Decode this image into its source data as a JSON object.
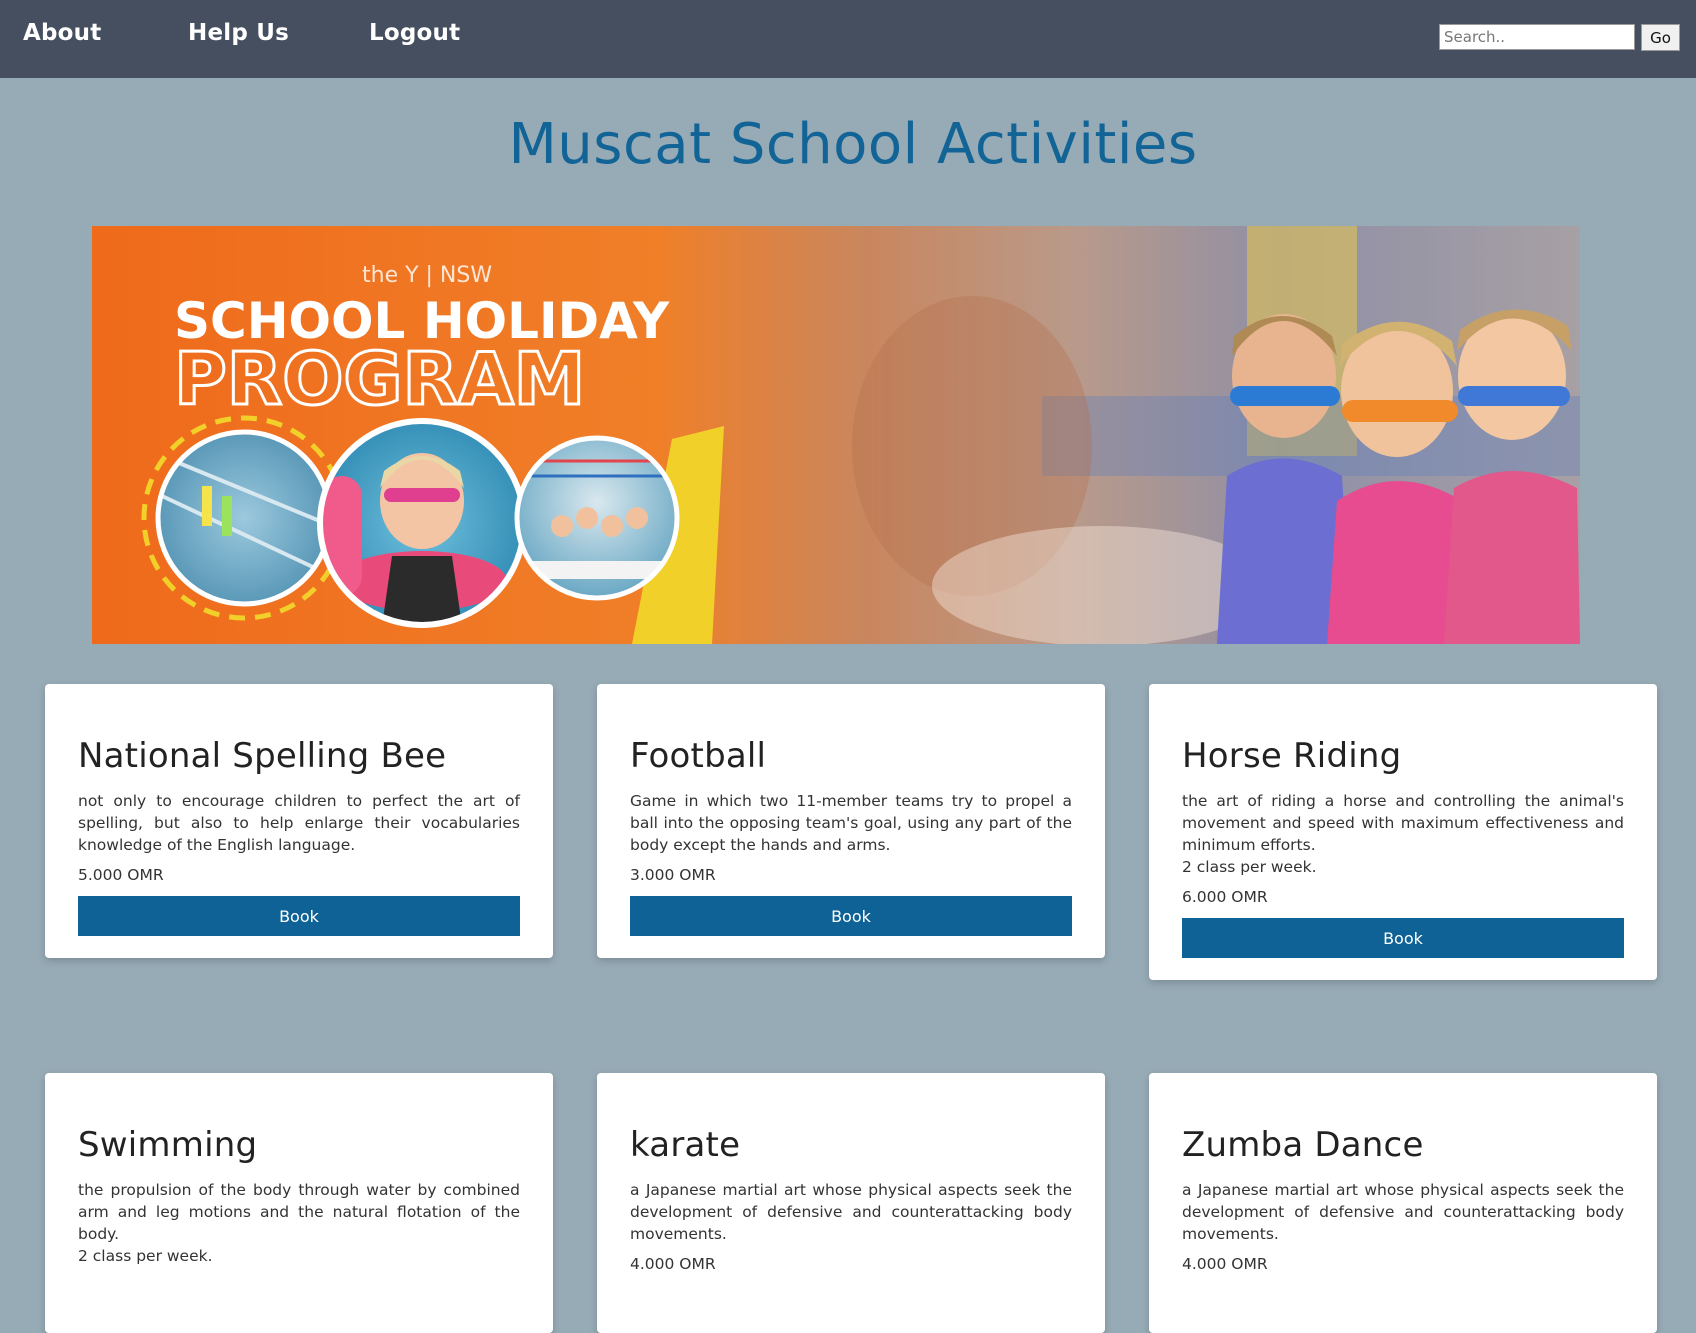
{
  "nav": {
    "about": "About",
    "help": "Help Us",
    "logout": "Logout",
    "search_placeholder": "Search..",
    "go": "Go"
  },
  "page_title": "Muscat School Activities",
  "banner": {
    "org": "the Y | NSW",
    "line1": "SCHOOL HOLIDAY",
    "line2": "PROGRAM"
  },
  "activities": [
    {
      "title": "National Spelling Bee",
      "description": "not only to encourage children to perfect the art of spelling, but also to help enlarge their vocabularies knowledge of the English language.",
      "price": "5.000 OMR",
      "button": "Book"
    },
    {
      "title": "Football",
      "description": "Game in which two 11-member teams try to propel a ball into the opposing team's goal, using any part of the body except the hands and arms.",
      "price": "3.000 OMR",
      "button": "Book"
    },
    {
      "title": "Horse Riding",
      "description": "the art of riding a horse and controlling the animal's movement and speed with maximum effectiveness and minimum efforts.",
      "extra": "2 class per week.",
      "price": "6.000 OMR",
      "button": "Book"
    },
    {
      "title": "Swimming",
      "description": "the propulsion of the body through water by combined arm and leg motions and the natural flotation of the body.",
      "extra": "2 class per week.",
      "price": ""
    },
    {
      "title": "karate",
      "description": "a Japanese martial art whose physical aspects seek the development of defensive and counterattacking body movements.",
      "price": "4.000 OMR"
    },
    {
      "title": "Zumba Dance",
      "description": "a Japanese martial art whose physical aspects seek the development of defensive and counterattacking body movements.",
      "price": "4.000 OMR"
    }
  ],
  "colors": {
    "nav_bg": "#454f5f",
    "page_bg": "#97abb6",
    "title": "#126497",
    "button": "#0f6296"
  }
}
